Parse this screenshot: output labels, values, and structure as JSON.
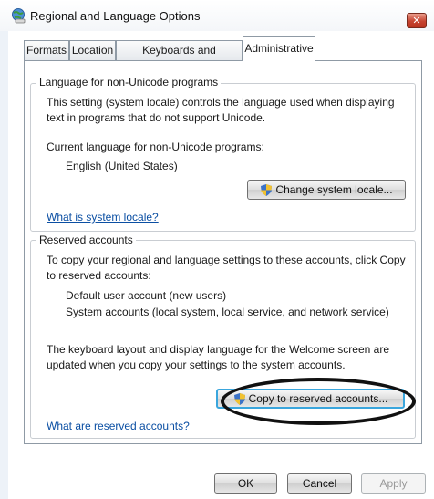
{
  "window": {
    "title": "Regional and Language Options",
    "close_glyph": "✕"
  },
  "tabs": [
    {
      "label": "Formats"
    },
    {
      "label": "Location"
    },
    {
      "label": "Keyboards and Languages"
    },
    {
      "label": "Administrative",
      "active": true
    }
  ],
  "non_unicode": {
    "group_title": "Language for non-Unicode programs",
    "description": "This setting (system locale) controls the language used when displaying text in programs that do not support Unicode.",
    "current_label": "Current language for non-Unicode programs:",
    "current_value": "English (United States)",
    "change_button": "Change system locale...",
    "help_link": "What is system locale?"
  },
  "reserved": {
    "group_title": "Reserved accounts",
    "description": "To copy your regional and language settings to these accounts, click Copy to reserved accounts:",
    "accounts": [
      "Default user account (new users)",
      "System accounts (local system, local service, and network service)"
    ],
    "note": "The keyboard layout and display language for the Welcome screen are updated when you copy your settings to the system accounts.",
    "copy_button": "Copy to reserved accounts...",
    "help_link": "What are reserved accounts?"
  },
  "footer": {
    "ok": "OK",
    "cancel": "Cancel",
    "apply": "Apply"
  },
  "icons": {
    "title": "globe-keyboard-icon",
    "shield": "uac-shield-icon"
  },
  "colors": {
    "link": "#0b4fa3",
    "close": "#c74431",
    "focus": "#3aa6dd"
  }
}
